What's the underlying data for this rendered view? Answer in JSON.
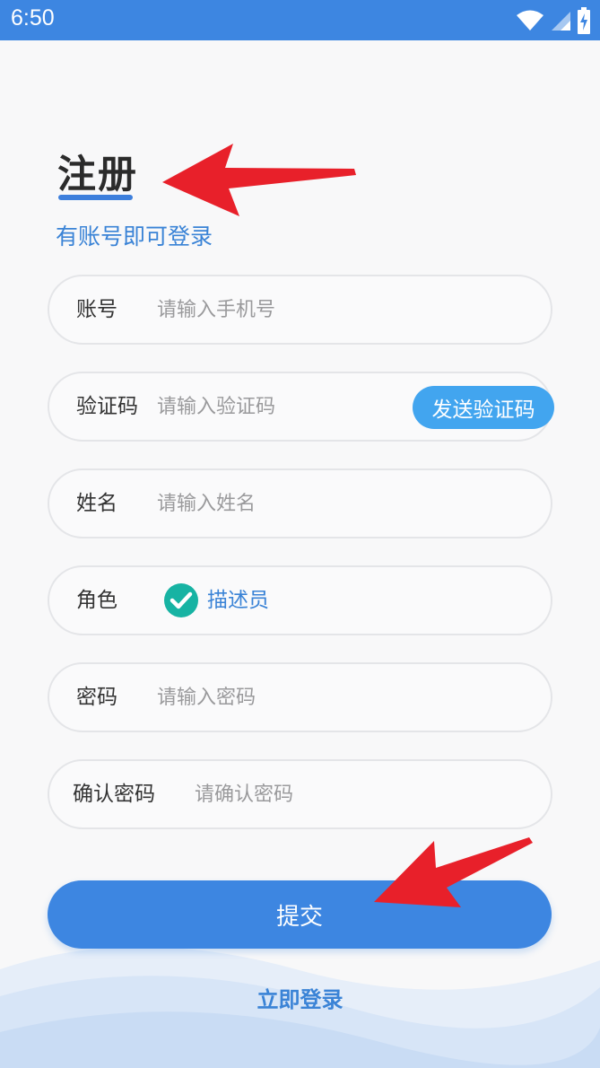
{
  "status_bar": {
    "time": "6:50",
    "icons": [
      "wifi-icon",
      "signal-icon",
      "battery-charging-icon"
    ]
  },
  "header": {
    "title": "注册",
    "subtitle": "有账号即可登录"
  },
  "form": {
    "account": {
      "label": "账号",
      "placeholder": "请输入手机号",
      "value": ""
    },
    "code": {
      "label": "验证码",
      "placeholder": "请输入验证码",
      "value": "",
      "send_button": "发送验证码"
    },
    "name": {
      "label": "姓名",
      "placeholder": "请输入姓名",
      "value": ""
    },
    "role": {
      "label": "角色",
      "option": "描述员",
      "checked": true
    },
    "password": {
      "label": "密码",
      "placeholder": "请输入密码",
      "value": ""
    },
    "confirm_password": {
      "label": "确认密码",
      "placeholder": "请确认密码",
      "value": ""
    }
  },
  "actions": {
    "submit": "提交",
    "login_link": "立即登录"
  },
  "colors": {
    "primary": "#3d86e1",
    "send_button": "#42a5ef",
    "check": "#17b3a3",
    "annotation_arrow": "#e8202a",
    "background": "#f8f8f9"
  },
  "annotations": [
    "red-arrow-to-title",
    "red-arrow-to-submit"
  ]
}
